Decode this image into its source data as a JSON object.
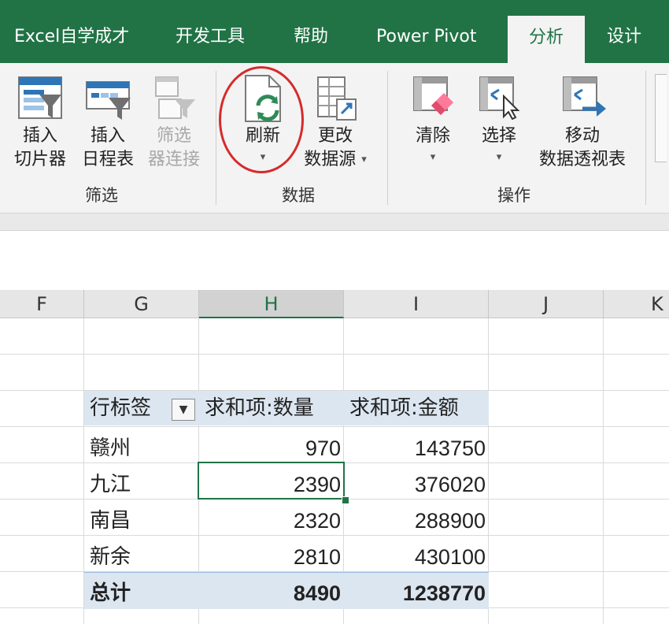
{
  "tabs": [
    "Excel自学成才",
    "开发工具",
    "帮助",
    "Power Pivot",
    "分析",
    "设计"
  ],
  "ribbon": {
    "filter_group": {
      "label": "筛选",
      "insert_slicer": [
        "插入",
        "切片器"
      ],
      "insert_timeline": [
        "插入",
        "日程表"
      ],
      "filter_connections": [
        "筛选",
        "器连接"
      ]
    },
    "data_group": {
      "label": "数据",
      "refresh": "刷新",
      "change_source": [
        "更改",
        "数据源"
      ]
    },
    "actions_group": {
      "label": "操作",
      "clear": "清除",
      "select": "选择",
      "move": [
        "移动",
        "数据透视表"
      ]
    }
  },
  "columns": [
    "F",
    "G",
    "H",
    "I",
    "J",
    "K"
  ],
  "pivot": {
    "headers": [
      "行标签",
      "求和项:数量",
      "求和项:金额"
    ],
    "rows": [
      {
        "label": "赣州",
        "qty": "970",
        "amount": "143750"
      },
      {
        "label": "九江",
        "qty": "2390",
        "amount": "376020"
      },
      {
        "label": "南昌",
        "qty": "2320",
        "amount": "288900"
      },
      {
        "label": "新余",
        "qty": "2810",
        "amount": "430100"
      }
    ],
    "total": {
      "label": "总计",
      "qty": "8490",
      "amount": "1238770"
    }
  },
  "colors": {
    "excel_green": "#217346",
    "pivot_header": "#dce6f1",
    "highlight_circle": "#d62b2b"
  }
}
